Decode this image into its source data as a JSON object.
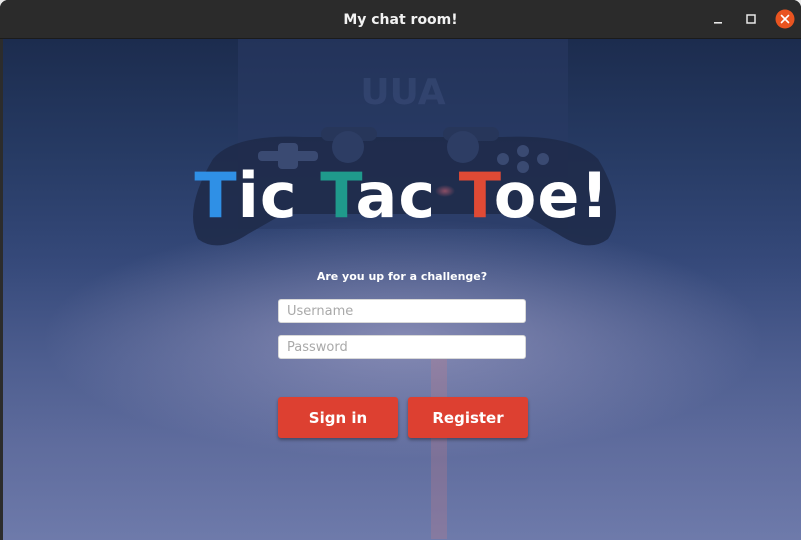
{
  "window": {
    "title": "My chat room!"
  },
  "logo": {
    "words": [
      {
        "initial": "T",
        "rest": "ic "
      },
      {
        "initial": "T",
        "rest": "ac "
      },
      {
        "initial": "T",
        "rest": "oe!"
      }
    ],
    "colors": {
      "first_initial": "#2f90e6",
      "second_initial": "#1f9a8c",
      "third_initial": "#e04a35",
      "rest": "#ffffff"
    }
  },
  "tagline": "Are you up for a challenge?",
  "form": {
    "username": {
      "placeholder": "Username",
      "value": ""
    },
    "password": {
      "placeholder": "Password",
      "value": ""
    }
  },
  "buttons": {
    "sign_in": "Sign in",
    "register": "Register",
    "color": "#dd4031"
  },
  "background": {
    "description_icon": "game-controller-image"
  }
}
